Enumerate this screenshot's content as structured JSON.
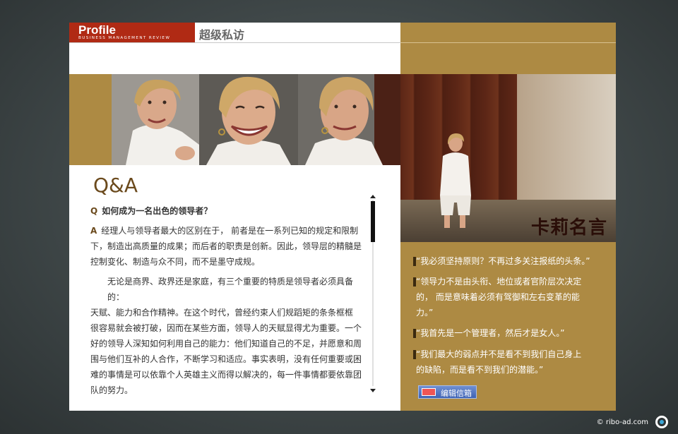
{
  "header": {
    "brand": "Profile",
    "brand_sub": "BUSINESS MANAGEMENT REVIEW",
    "section_title": "超级私访"
  },
  "qa": {
    "heading": "Q&A",
    "q_mark": "Q",
    "question": "如何成为一名出色的领导者？",
    "a_mark": "A",
    "answer_lines": [
      "经理人与领导者最大的区别在于， 前者是在一系列已知的规定和限制",
      "下，制造出高质量的成果；而后者的职责是创新。因此，领导层的精髓是",
      "控制变化、制造与众不同，而不是墨守成规。"
    ],
    "para2_lines": [
      "无论是商界、政界还是家庭，有三个重要的特质是领导者必须具备的：",
      "天赋、能力和合作精神。在这个时代，曾经约束人们规蹈矩的条条框框",
      "很容易就会被打破，因而在某些方面，领导人的天赋显得尤为重要。一个",
      "好的领导人深知如何利用自己的能力：他们知道自己的不足，并愿意和周",
      "围与他们互补的人合作，不断学习和适应。事实表明，没有任何重要或困",
      "难的事情是可以依靠个人英雄主义而得以解决的，每一件事情都要依靠团",
      "队的努力。"
    ]
  },
  "quotes": {
    "title": "卡莉名言",
    "items": [
      [
        "“我必须坚持原则？不再过多关注报纸的头条。”"
      ],
      [
        "“领导力不是由头衔、地位或者官阶层次决定",
        "的， 而是意味着必须有驾御和左右变革的能",
        "力。”"
      ],
      [
        "“我首先是一个管理者，然后才是女人。”"
      ],
      [
        "“我们最大的弱点并不是看不到我们自己身上",
        "的缺陷，而是看不到我们的潜能。”"
      ]
    ],
    "mail_button": "编辑信箱"
  },
  "footer": {
    "copyright": "© ribo-ad.com"
  },
  "colors": {
    "gold": "#ad8a43",
    "brand_red": "#b02a14",
    "qa_brown": "#6b4a1d"
  }
}
